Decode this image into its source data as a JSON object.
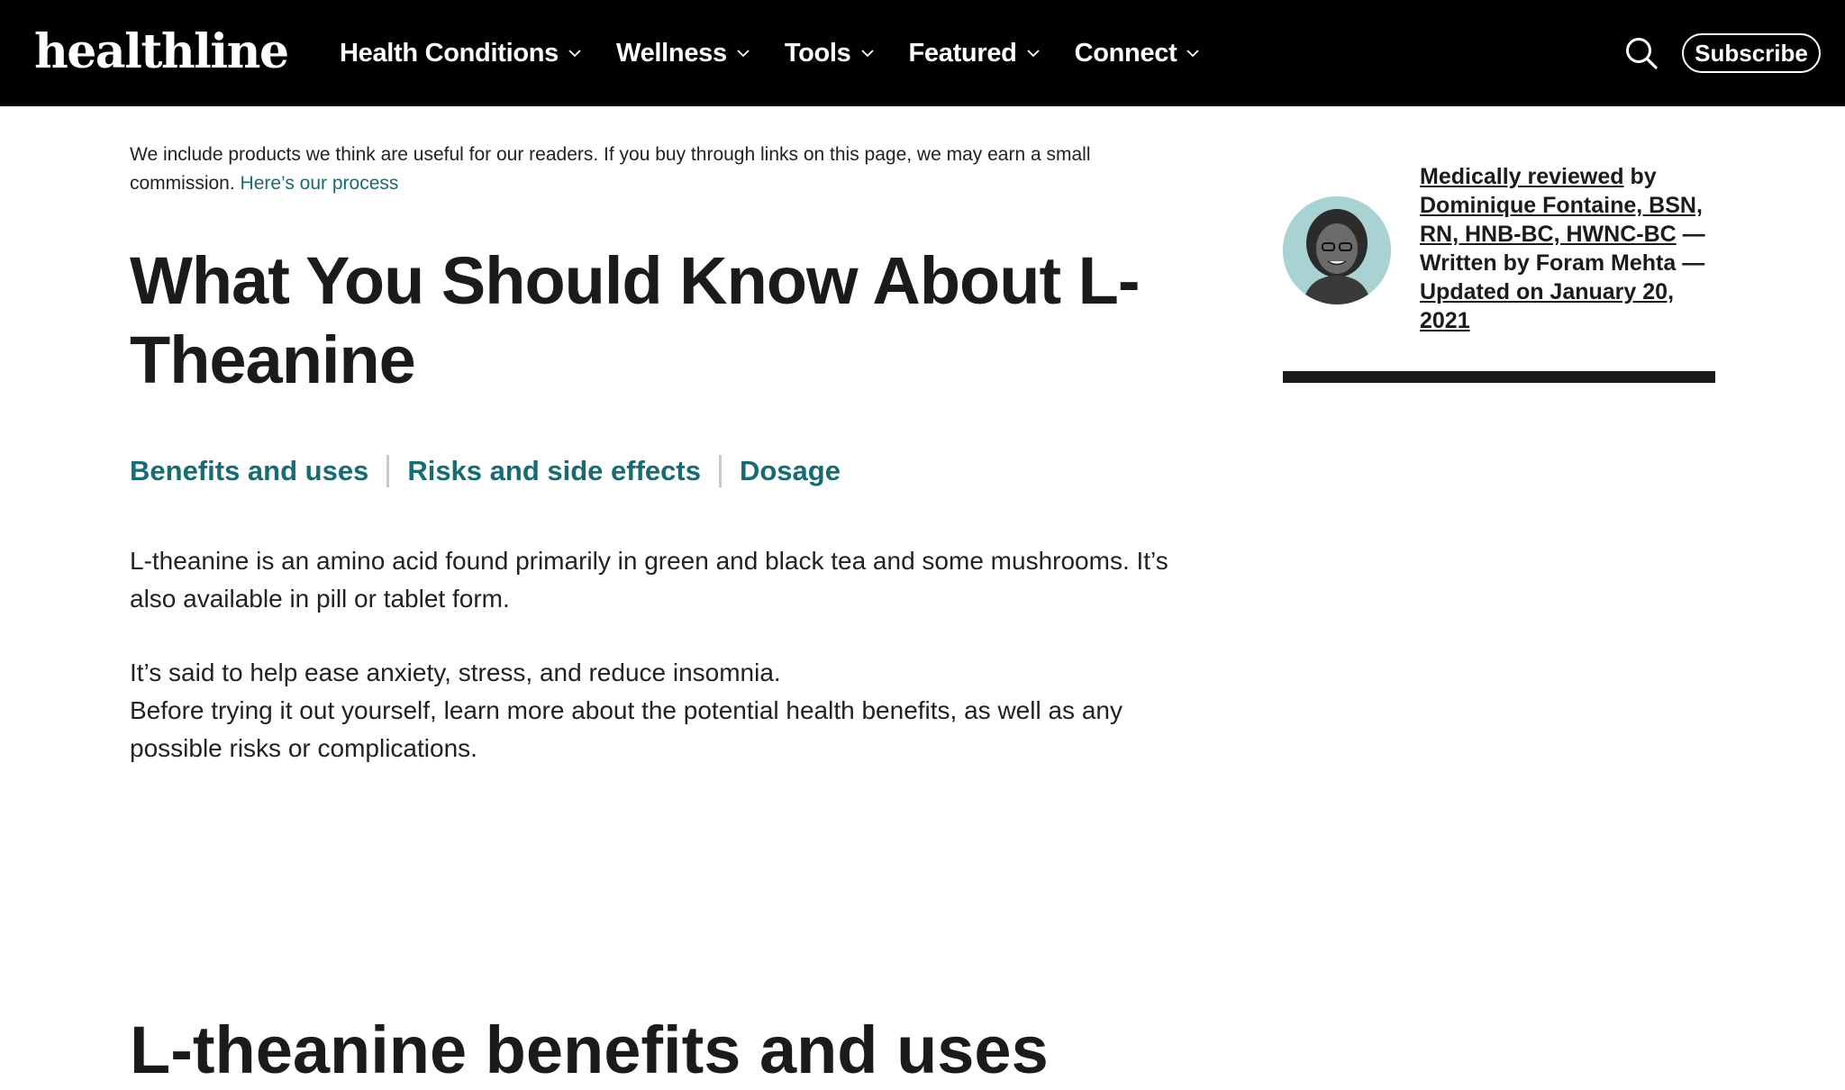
{
  "header": {
    "logo": "healthline",
    "nav": [
      "Health Conditions",
      "Wellness",
      "Tools",
      "Featured",
      "Connect"
    ],
    "subscribe_label": "Subscribe"
  },
  "disclaimer": {
    "text": "We include products we think are useful for our readers. If you buy through links on this page, we may earn a small commission. ",
    "link": "Here’s our process"
  },
  "article": {
    "title": "What You Should Know About L-Theanine",
    "jump_links": [
      "Benefits and uses",
      "Risks and side effects",
      "Dosage"
    ],
    "paragraph_1": "L-theanine is an amino acid found primarily in green and black tea and some mushrooms. It’s also available in pill or tablet form.",
    "paragraph_2a": "It’s said to help ease anxiety, stress, and reduce insomnia.",
    "paragraph_2b": "Before trying it out yourself, learn more about the potential health benefits, as well as any possible risks or complications.",
    "section_heading": "L-theanine benefits and uses"
  },
  "byline": {
    "reviewed_label": "Medically reviewed",
    "by": " by ",
    "reviewer": "Dominique Fontaine, BSN, RN, HNB-BC, HWNC-BC",
    "written": " — Written by Foram Mehta — ",
    "updated": "Updated on January 20, 2021"
  },
  "colors": {
    "accent_teal": "#176b73",
    "nav_background": "#000000",
    "text": "#1b1b1b"
  },
  "icons": {
    "search": "search-icon",
    "dropdown": "chevron-down-icon"
  }
}
